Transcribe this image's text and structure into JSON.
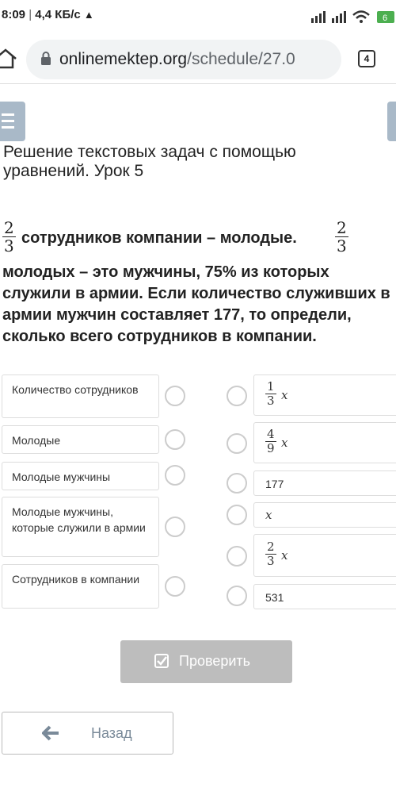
{
  "status_bar": {
    "time": "8:09",
    "speed": "4,4 КБ/с",
    "battery": "6"
  },
  "browser": {
    "url_host": "onlinemektep.org",
    "url_path": "/schedule/27.0",
    "tab_count": "4"
  },
  "page": {
    "title": "Решение текстовых задач с помощью уравнений. Урок 5"
  },
  "question": {
    "frac1": {
      "num": "2",
      "den": "3"
    },
    "text1": "сотрудников компании – молодые.",
    "frac2": {
      "num": "2",
      "den": "3"
    },
    "text2": " молодых – это мужчины, 75% из которых служили в армии. Если количество служивших в армии мужчин составляет 177, то определи, сколько всего сотрудников в компании."
  },
  "left_items": [
    "Количество сотрудников",
    "Молодые",
    "Молодые мужчины",
    "Молодые мужчины, которые служили в армии",
    "Сотрудников в компании"
  ],
  "right_items": {
    "r0": {
      "num": "1",
      "den": "3",
      "var": "x"
    },
    "r1": {
      "num": "4",
      "den": "9",
      "var": "x"
    },
    "r2": "177",
    "r3": "x",
    "r4": {
      "num": "2",
      "den": "3",
      "var": "x"
    },
    "r5": "531"
  },
  "buttons": {
    "check": "Проверить",
    "back": "Назад"
  },
  "colors": {
    "button_disabled": "#bdbdbd",
    "menu_button": "#a9b9c8"
  }
}
